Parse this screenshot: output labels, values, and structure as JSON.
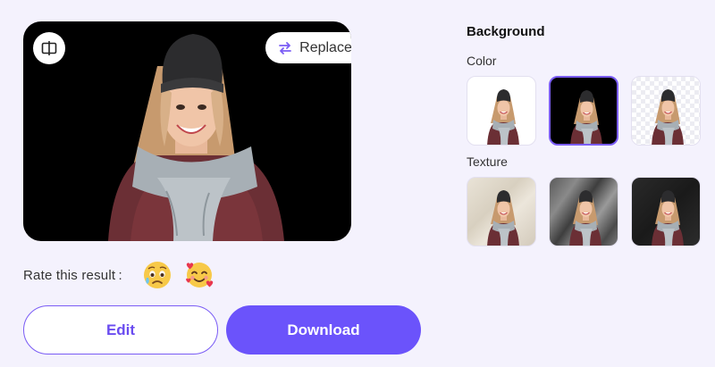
{
  "preview": {
    "replace_label": "Replace",
    "compare_icon": "compare-split-icon",
    "replace_icon": "swap-arrows-icon"
  },
  "rating": {
    "label": "Rate this result :",
    "options": [
      {
        "icon": "sad-sweat-emoji"
      },
      {
        "icon": "smiling-hearts-emoji"
      }
    ]
  },
  "actions": {
    "edit_label": "Edit",
    "download_label": "Download"
  },
  "background_panel": {
    "title": "Background",
    "color_label": "Color",
    "texture_label": "Texture",
    "color_options": [
      {
        "name": "white",
        "color": "#ffffff",
        "selected": false
      },
      {
        "name": "black",
        "color": "#000000",
        "selected": true
      },
      {
        "name": "transparent",
        "color": "checkerboard",
        "selected": false
      }
    ],
    "texture_options": [
      {
        "name": "paper"
      },
      {
        "name": "marble"
      },
      {
        "name": "dark-fabric"
      }
    ]
  },
  "colors": {
    "accent": "#6b53fb",
    "page_background": "#f4f2fd"
  }
}
